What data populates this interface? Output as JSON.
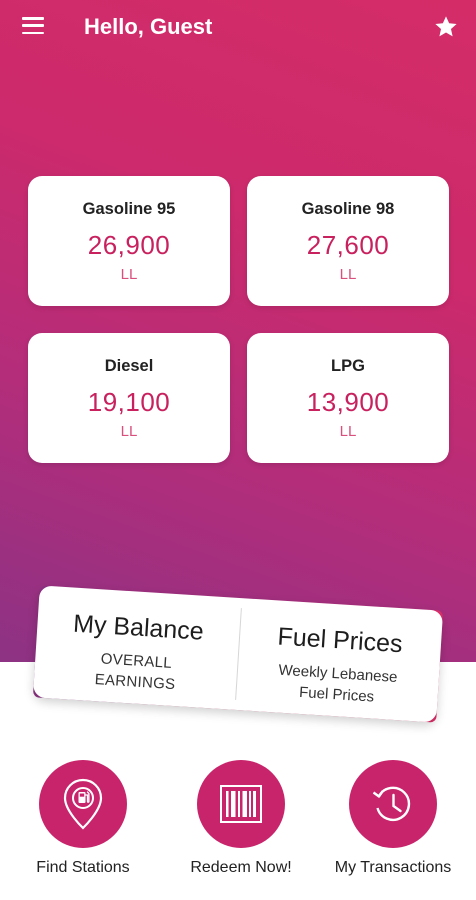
{
  "header": {
    "greeting": "Hello, Guest",
    "menu_icon": "hamburger-menu-icon",
    "favorite_icon": "star-icon"
  },
  "prices": [
    {
      "name": "Gasoline 95",
      "price": "26,900",
      "unit": "LL"
    },
    {
      "name": "Gasoline 98",
      "price": "27,600",
      "unit": "LL"
    },
    {
      "name": "Diesel",
      "price": "19,100",
      "unit": "LL"
    },
    {
      "name": "LPG",
      "price": "13,900",
      "unit": "LL"
    }
  ],
  "info_card": {
    "balance_title": "My Balance",
    "balance_sub_line1": "OVERALL",
    "balance_sub_line2": "EARNINGS",
    "fuel_title": "Fuel Prices",
    "fuel_sub_line1": "Weekly Lebanese",
    "fuel_sub_line2": "Fuel Prices"
  },
  "actions": [
    {
      "label": "Find Stations",
      "icon": "fuel-location-pin-icon"
    },
    {
      "label": "Redeem Now!",
      "icon": "barcode-icon"
    },
    {
      "label": "My Transactions",
      "icon": "history-clock-icon"
    }
  ],
  "colors": {
    "primary": "#c8246b",
    "gradient_top": "#d42c67",
    "gradient_bottom": "#8d3284",
    "price_text": "#c8215e"
  }
}
